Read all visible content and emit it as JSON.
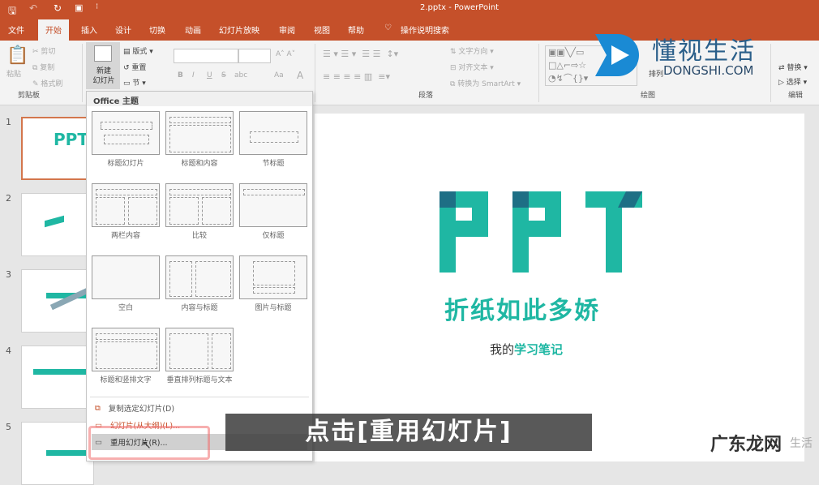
{
  "window": {
    "title": "2.pptx  -  PowerPoint"
  },
  "tabs": [
    "文件",
    "开始",
    "插入",
    "设计",
    "切换",
    "动画",
    "幻灯片放映",
    "审阅",
    "视图",
    "帮助"
  ],
  "tell_me": "操作说明搜索",
  "ribbon": {
    "clipboard": {
      "paste": "粘贴",
      "cut": "剪切",
      "copy": "复制",
      "format_painter": "格式刷",
      "label": "剪贴板"
    },
    "slides": {
      "new_slide": "新建\n幻灯片",
      "layout": "版式",
      "reset": "重置",
      "section": "节"
    },
    "font": {
      "bold": "B",
      "italic": "I",
      "underline": "U",
      "strike": "S",
      "abc": "abc",
      "case": "Aa"
    },
    "paragraph": {
      "text_direction": "文字方向",
      "align_text": "对齐文本",
      "smartart": "转换为 SmartArt",
      "label": "段落"
    },
    "drawing": {
      "arrange": "排列",
      "label": "绘图"
    },
    "editing": {
      "replace": "替换",
      "select": "选择",
      "label": "编辑"
    }
  },
  "menu": {
    "header": "Office 主题",
    "layouts": [
      "标题幻灯片",
      "标题和内容",
      "节标题",
      "两栏内容",
      "比较",
      "仅标题",
      "空白",
      "内容与标题",
      "图片与标题",
      "标题和竖排文字",
      "垂直排列标题与文本"
    ],
    "items": [
      "复制选定幻灯片(D)",
      "幻灯片(从大纲)(L)...",
      "重用幻灯片(R)..."
    ]
  },
  "slide_numbers": [
    "1",
    "2",
    "3",
    "4",
    "5"
  ],
  "slide": {
    "title": "PPT",
    "subtitle": "折纸如此多娇",
    "note_prefix": "我的",
    "note_highlight": "学习笔记"
  },
  "caption": "点击[重用幻灯片]",
  "watermarks": {
    "brand": "懂视生活",
    "brand_url": "DONGSHI.COM",
    "corner": "广东龙网",
    "corner2": "生活"
  },
  "colors": {
    "accent": "#c5502a",
    "teal": "#1fb7a3",
    "dark_teal": "#1e6f85"
  }
}
